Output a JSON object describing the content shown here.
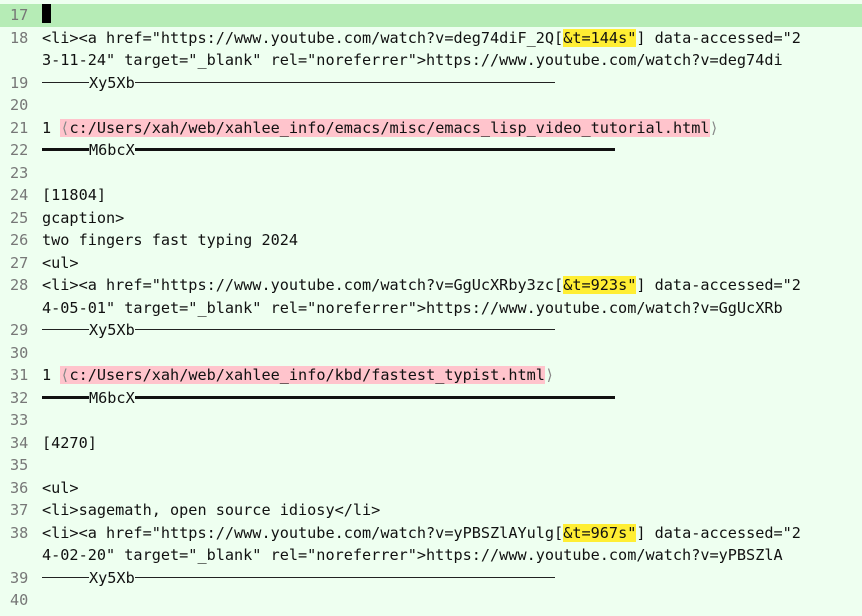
{
  "lines": [
    {
      "n": "17",
      "kind": "cursor"
    },
    {
      "n": "18",
      "kind": "li_link",
      "pre": "<li><a href=\"https://www.youtube.com/watch?v=deg74diF_2Q[",
      "hl": "&t=144s\"",
      "post": "] data-accessed=\"2"
    },
    {
      "n": "",
      "kind": "text",
      "text": "3-11-24\" target=\"_blank\" rel=\"noreferrer\">https://www.youtube.com/watch?v=deg74di"
    },
    {
      "n": "19",
      "kind": "rule",
      "label": "Xy5Xb"
    },
    {
      "n": "20",
      "kind": "empty"
    },
    {
      "n": "21",
      "kind": "path",
      "num": "1",
      "path": "c:/Users/xah/web/xahlee_info/emacs/misc/emacs_lisp_video_tutorial.html"
    },
    {
      "n": "22",
      "kind": "rule_thick",
      "label": "M6bcX"
    },
    {
      "n": "23",
      "kind": "empty"
    },
    {
      "n": "24",
      "kind": "text",
      "text": "[11804]"
    },
    {
      "n": "25",
      "kind": "text",
      "text": "gcaption>"
    },
    {
      "n": "26",
      "kind": "text",
      "text": "two fingers fast typing 2024"
    },
    {
      "n": "27",
      "kind": "text",
      "text": "<ul>"
    },
    {
      "n": "28",
      "kind": "li_link",
      "pre": "<li><a href=\"https://www.youtube.com/watch?v=GgUcXRby3zc[",
      "hl": "&t=923s\"",
      "post": "] data-accessed=\"2"
    },
    {
      "n": "",
      "kind": "text",
      "text": "4-05-01\" target=\"_blank\" rel=\"noreferrer\">https://www.youtube.com/watch?v=GgUcXRb"
    },
    {
      "n": "29",
      "kind": "rule",
      "label": "Xy5Xb"
    },
    {
      "n": "30",
      "kind": "empty"
    },
    {
      "n": "31",
      "kind": "path",
      "num": "1",
      "path": "c:/Users/xah/web/xahlee_info/kbd/fastest_typist.html"
    },
    {
      "n": "32",
      "kind": "rule_thick",
      "label": "M6bcX"
    },
    {
      "n": "33",
      "kind": "empty"
    },
    {
      "n": "34",
      "kind": "text",
      "text": "[4270]"
    },
    {
      "n": "35",
      "kind": "empty"
    },
    {
      "n": "36",
      "kind": "text",
      "text": "<ul>"
    },
    {
      "n": "37",
      "kind": "text",
      "text": "<li>sagemath, open source idiosy</li>"
    },
    {
      "n": "38",
      "kind": "li_link",
      "pre": "<li><a href=\"https://www.youtube.com/watch?v=yPBSZlAYulg[",
      "hl": "&t=967s\"",
      "post": "] data-accessed=\"2"
    },
    {
      "n": "",
      "kind": "text",
      "text": "4-02-20\" target=\"_blank\" rel=\"noreferrer\">https://www.youtube.com/watch?v=yPBSZlA"
    },
    {
      "n": "39",
      "kind": "rule",
      "label": "Xy5Xb"
    },
    {
      "n": "40",
      "kind": "empty"
    }
  ],
  "colors": {
    "background": "#eefff0",
    "current_line": "#b6ecb6",
    "highlight_time": "#ffee33",
    "highlight_path": "#ffc4cc"
  }
}
